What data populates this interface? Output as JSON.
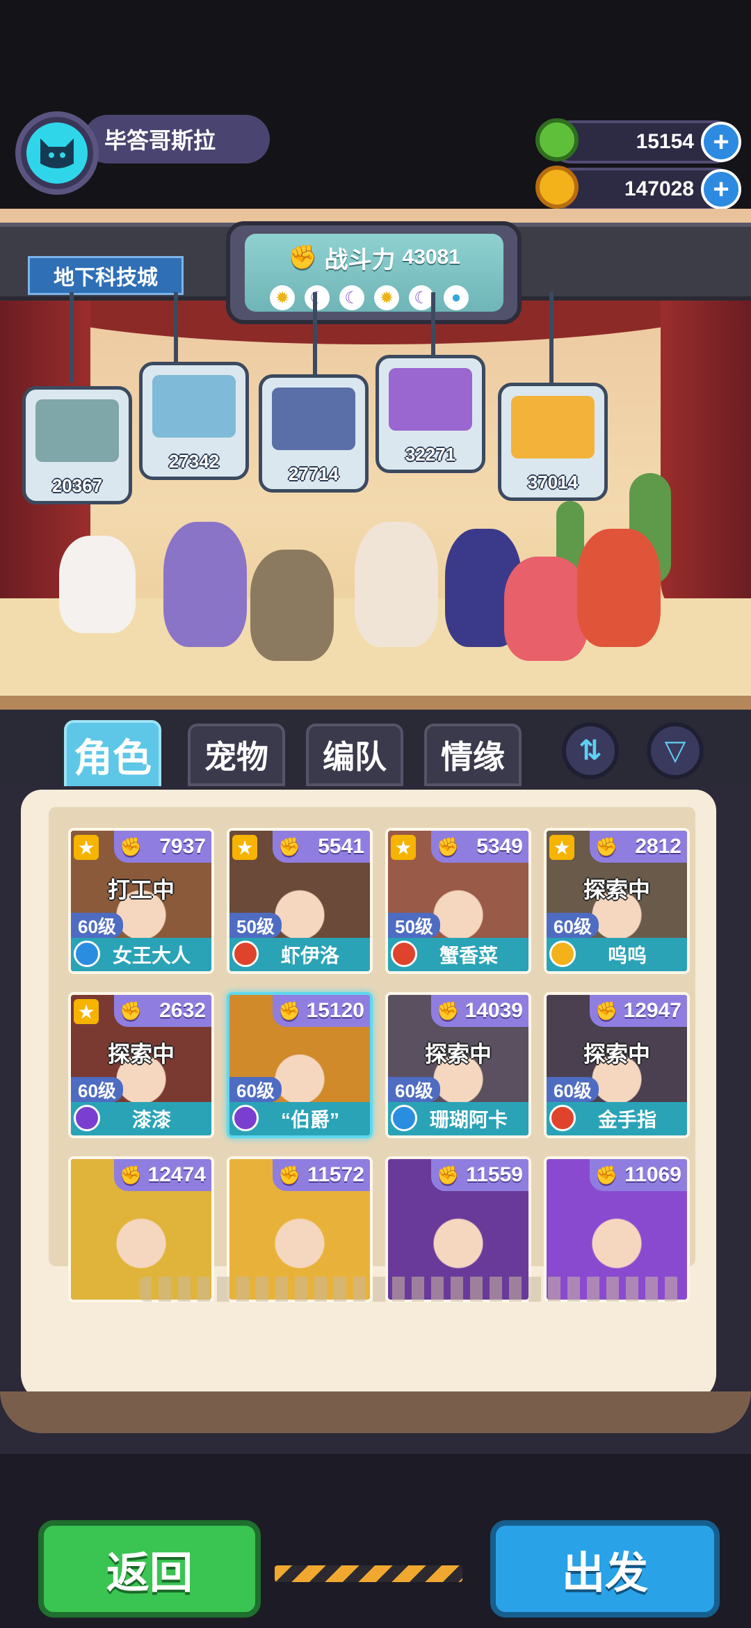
{
  "player": {
    "name": "毕答哥斯拉",
    "avatar_icon": "cat-icon"
  },
  "currency": [
    {
      "icon": "green-gem-icon",
      "value": "15154",
      "color": "#5fbf3a"
    },
    {
      "icon": "gold-coin-icon",
      "value": "147028",
      "color": "#f3b21a"
    }
  ],
  "location": "地下科技城",
  "power": {
    "label": "战斗力",
    "value": "43081",
    "elements": [
      "sun",
      "moon",
      "moon",
      "sun",
      "moon",
      "drop"
    ]
  },
  "pets": [
    {
      "power": "20367",
      "color": "#7fa6a8"
    },
    {
      "power": "27342",
      "color": "#7fbbd8"
    },
    {
      "power": "27714",
      "color": "#5a6fa8"
    },
    {
      "power": "32271",
      "color": "#9a66d0"
    },
    {
      "power": "37014",
      "color": "#f3b33a"
    }
  ],
  "tabs": [
    "角色",
    "宠物",
    "编队",
    "情缘"
  ],
  "tab_buttons": {
    "sort": "⇅",
    "filter": "▽"
  },
  "characters": [
    {
      "power": "7937",
      "status": "打工中",
      "level": "60级",
      "name": "女王大人",
      "star": true,
      "badge": "#2b8de0",
      "art": "#8a5a3a"
    },
    {
      "power": "5541",
      "status": "",
      "level": "50级",
      "name": "虾伊洛",
      "star": true,
      "badge": "#e0432b",
      "art": "#6b4a3a"
    },
    {
      "power": "5349",
      "status": "",
      "level": "50级",
      "name": "蟹香菜",
      "star": true,
      "badge": "#e0432b",
      "art": "#9a5a48"
    },
    {
      "power": "2812",
      "status": "探索中",
      "level": "60级",
      "name": "呜呜",
      "star": true,
      "badge": "#f3b21a",
      "art": "#6a5a4a"
    },
    {
      "power": "2632",
      "status": "探索中",
      "level": "60级",
      "name": "漆漆",
      "star": true,
      "badge": "#7a3fd0",
      "art": "#7a3a32"
    },
    {
      "power": "15120",
      "status": "",
      "level": "60级",
      "name": "“伯爵”",
      "star": false,
      "badge": "#7a3fd0",
      "art": "#d08a2a",
      "selected": true
    },
    {
      "power": "14039",
      "status": "探索中",
      "level": "60级",
      "name": "珊瑚阿卡",
      "star": false,
      "badge": "#2b8de0",
      "art": "#5a5060"
    },
    {
      "power": "12947",
      "status": "探索中",
      "level": "60级",
      "name": "金手指",
      "star": false,
      "badge": "#e0432b",
      "art": "#4a4050"
    },
    {
      "power": "12474",
      "status": "",
      "level": "",
      "name": "",
      "star": false,
      "badge": "",
      "art": "#e0b43a"
    },
    {
      "power": "11572",
      "status": "",
      "level": "",
      "name": "",
      "star": false,
      "badge": "",
      "art": "#e8b23a"
    },
    {
      "power": "11559",
      "status": "",
      "level": "",
      "name": "",
      "star": false,
      "badge": "",
      "art": "#6a3a9a"
    },
    {
      "power": "11069",
      "status": "",
      "level": "",
      "name": "",
      "star": false,
      "badge": "",
      "art": "#8a4ad0"
    }
  ],
  "buttons": {
    "back": "返回",
    "go": "出发"
  }
}
